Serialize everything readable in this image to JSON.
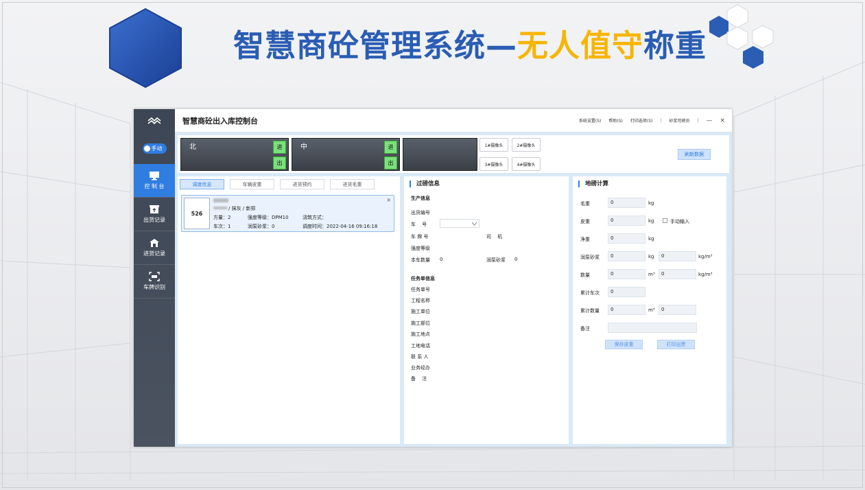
{
  "slide": {
    "title_main": "智慧商砼管理系统—",
    "title_highlight": "无人值守",
    "title_tail": "称重",
    "colors": {
      "title_blue": "#2a5db3",
      "title_yellow": "#f7b500",
      "accent": "#2f7de1"
    }
  },
  "app": {
    "title": "智慧商砼出入库控制台",
    "menu": [
      "系统设置(S)",
      "帮助(S)",
      "打印选项(S)",
      "|",
      "砂浆司磅员",
      "|"
    ],
    "window_controls": {
      "minimize": "—",
      "close": "×"
    }
  },
  "sidebar": {
    "logo_icon": "brand-logo-icon",
    "mode_label": "手动",
    "items": [
      {
        "label": "控 制 台",
        "icon": "monitor-icon",
        "active": true
      },
      {
        "label": "出货记录",
        "icon": "outbound-box-icon",
        "active": false
      },
      {
        "label": "进货记录",
        "icon": "inbound-house-icon",
        "active": false
      },
      {
        "label": "车牌识别",
        "icon": "plate-scan-icon",
        "active": false
      }
    ]
  },
  "lanes": [
    {
      "name": "北",
      "in": "进",
      "out": "出"
    },
    {
      "name": "中",
      "in": "进",
      "out": "出"
    }
  ],
  "cameras": [
    "1#摄像头",
    "2#摄像头",
    "3#摄像头",
    "4#摄像头"
  ],
  "refresh_label": "刷新数据",
  "tabs": [
    "调度信息",
    "车辆皮重",
    "进货预约",
    "进货毛重"
  ],
  "dispatch_card": {
    "number": "526",
    "line1": "/ 抹灰 / 新郑",
    "volume": "方量：2",
    "strength": "强度等级：DPM10",
    "pour": "浇筑方式：",
    "trips": "车次：1",
    "pump_mortar": "润泵砂浆：0",
    "dispatch_time": "调度时间：2022-04-16 09:16:18",
    "close": "×"
  },
  "weigh_info": {
    "title": "过磅信息",
    "production_title": "生产信息",
    "shipment_no": "出货编号",
    "vehicle_no": "车　 号",
    "plate_no": "车 牌 号",
    "driver": "司　 机",
    "strength": "强度等级",
    "qty_label": "本车数量",
    "qty_value": "0",
    "pump_label": "润泵砂浆",
    "pump_value": "0",
    "task_title": "任务单信息",
    "task_fields": [
      "任务单号",
      "工程名称",
      "施工单位",
      "施工部位",
      "施工地点",
      "工地电话",
      "联 系 人",
      "业务经办",
      "备　 注"
    ]
  },
  "calc": {
    "title": "地磅计算",
    "gross": {
      "label": "毛重",
      "value": "0",
      "unit": "kg"
    },
    "tare": {
      "label": "皮重",
      "value": "0",
      "unit": "kg",
      "manual": "手动输入"
    },
    "net": {
      "label": "净重",
      "value": "0",
      "unit": "kg"
    },
    "pump": {
      "label": "润泵砂浆",
      "value": "0",
      "unit": "kg",
      "value2": "0",
      "unit2": "kg/m³"
    },
    "qty": {
      "label": "数量",
      "value": "0",
      "unit": "m³",
      "value2": "0",
      "unit2": "kg/m³"
    },
    "total_trips": {
      "label": "累计车次",
      "value": "0"
    },
    "total_qty": {
      "label": "累计数量",
      "value": "0",
      "unit": "m³",
      "value2": "0"
    },
    "remark": {
      "label": "备注",
      "value": ""
    },
    "save_btn": "保存皮重",
    "print_btn": "打印出票"
  }
}
